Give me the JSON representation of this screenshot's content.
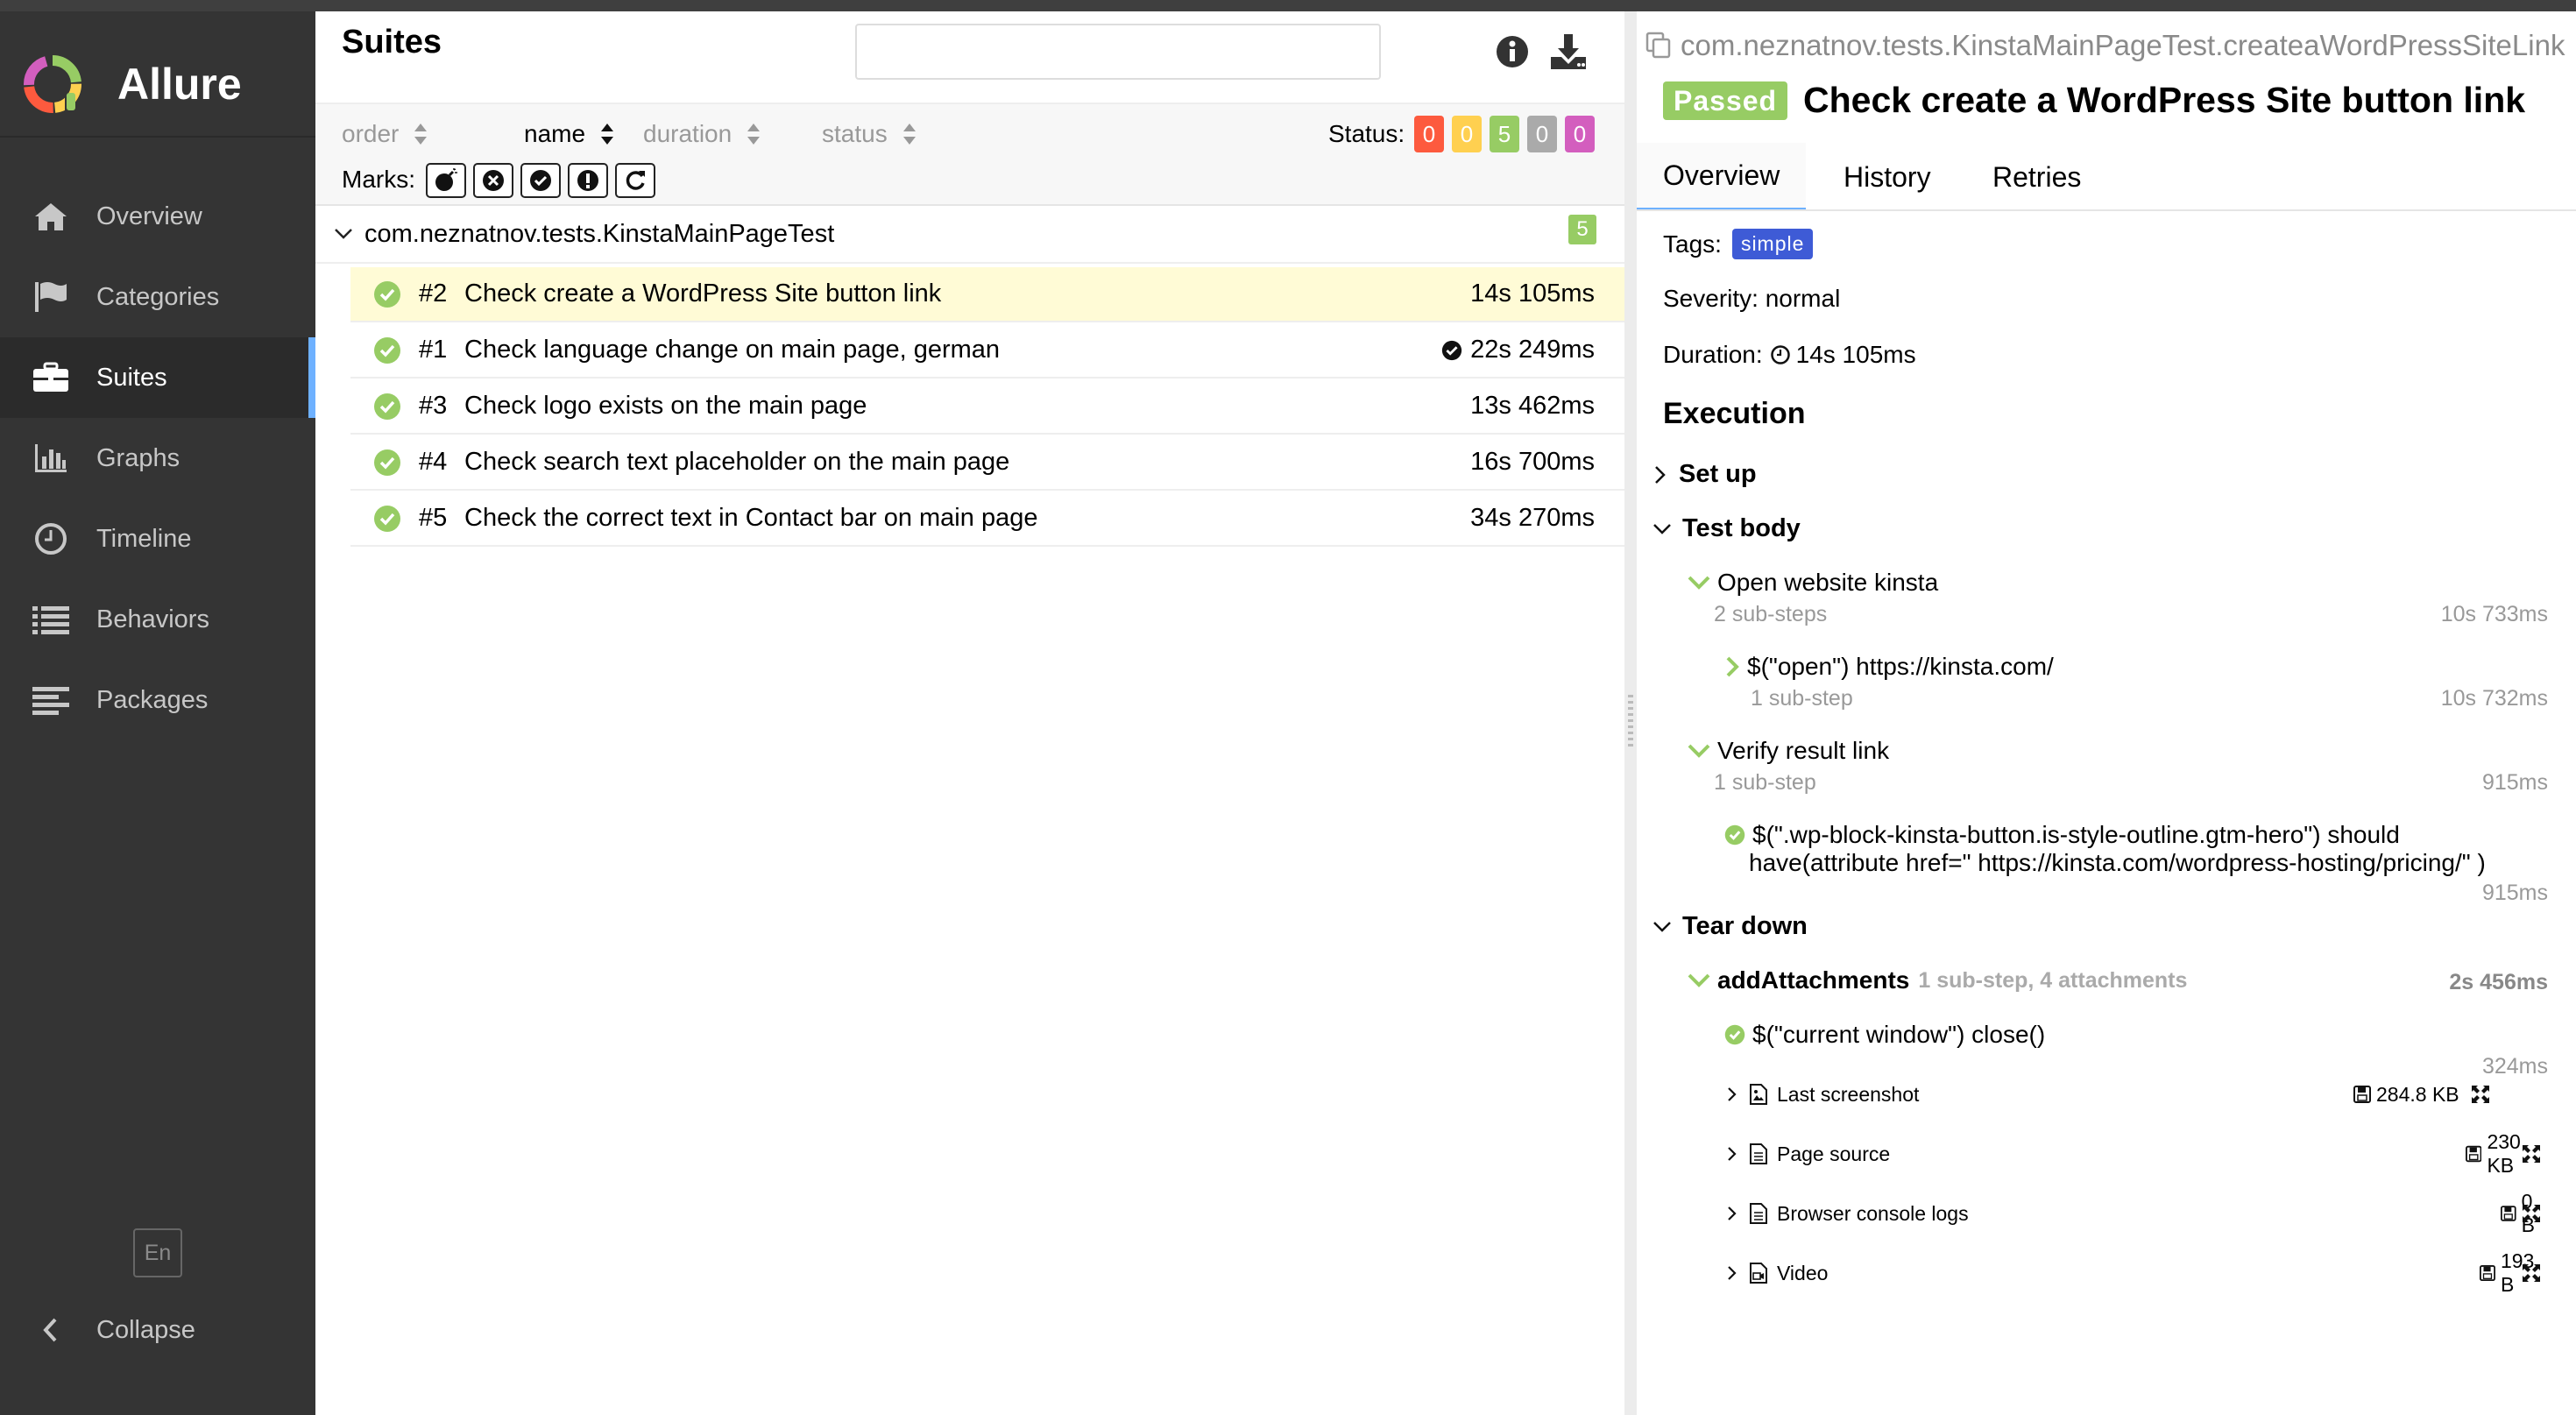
{
  "app": {
    "name": "Allure",
    "accent": "#6eb1ff"
  },
  "nav": [
    {
      "label": "Overview",
      "icon": "home-icon"
    },
    {
      "label": "Categories",
      "icon": "flag-icon"
    },
    {
      "label": "Suites",
      "icon": "briefcase-icon",
      "active": true
    },
    {
      "label": "Graphs",
      "icon": "bar-chart-icon"
    },
    {
      "label": "Timeline",
      "icon": "clock-icon"
    },
    {
      "label": "Behaviors",
      "icon": "list-icon"
    },
    {
      "label": "Packages",
      "icon": "align-left-icon"
    }
  ],
  "language": "En",
  "collapse_label": "Collapse",
  "suites": {
    "title": "Suites",
    "search_value": "",
    "sort": {
      "order": "order",
      "name": "name",
      "duration": "duration",
      "status": "status",
      "active": "name"
    },
    "status_label": "Status:",
    "status_counts": [
      {
        "value": "0",
        "color": "#fd5a3e"
      },
      {
        "value": "0",
        "color": "#ffd050"
      },
      {
        "value": "5",
        "color": "#97cc64"
      },
      {
        "value": "0",
        "color": "#aaaaaa"
      },
      {
        "value": "0",
        "color": "#d35ebe"
      }
    ],
    "marks_label": "Marks:",
    "group": {
      "name": "com.neznatnov.tests.KinstaMainPageTest",
      "count": "5"
    },
    "tests": [
      {
        "num": "#2",
        "name": "Check create a WordPress Site button link",
        "duration": "14s 105ms",
        "selected": true
      },
      {
        "num": "#1",
        "name": "Check language change on main page, german",
        "duration": "22s 249ms",
        "flag": true
      },
      {
        "num": "#3",
        "name": "Check logo exists on the main page",
        "duration": "13s 462ms"
      },
      {
        "num": "#4",
        "name": "Check search text placeholder on the main page",
        "duration": "16s 700ms"
      },
      {
        "num": "#5",
        "name": "Check the correct text in Contact bar on main page",
        "duration": "34s 270ms"
      }
    ]
  },
  "detail": {
    "full_name": "com.neznatnov.tests.KinstaMainPageTest.createaWordPressSiteLink",
    "status": "Passed",
    "title": "Check create a WordPress Site button link",
    "tabs": [
      "Overview",
      "History",
      "Retries"
    ],
    "tags_label": "Tags:",
    "tag": "simple",
    "severity": "Severity: normal",
    "duration_label": "Duration:",
    "duration": "14s 105ms",
    "execution": "Execution",
    "setup": "Set up",
    "test_body": "Test body",
    "steps": {
      "open": {
        "name": "Open website kinsta",
        "sub": "2 sub-steps",
        "time": "10s 733ms"
      },
      "open_url": {
        "name": "$(\"open\") https://kinsta.com/",
        "sub": "1 sub-step",
        "time": "10s 732ms"
      },
      "verify": {
        "name": "Verify result link",
        "sub": "1 sub-step",
        "time": "915ms"
      },
      "verify_should_1": "$(\".wp-block-kinsta-button.is-style-outline.gtm-hero\") should",
      "verify_should_2": "have(attribute href=\" https://kinsta.com/wordpress-hosting/pricing/\" )",
      "verify_should_time": "915ms"
    },
    "teardown": "Tear down",
    "add_attachments": {
      "name": "addAttachments",
      "sub": "1 sub-step, 4 attachments",
      "time": "2s 456ms"
    },
    "close": {
      "name": "$(\"current window\") close()",
      "time": "324ms"
    },
    "attachments": [
      {
        "name": "Last screenshot",
        "size": "284.8 KB",
        "icon": "image-file-icon"
      },
      {
        "name": "Page source",
        "size": "230 KB",
        "icon": "text-file-icon"
      },
      {
        "name": "Browser console logs",
        "size": "0 B",
        "icon": "text-file-icon"
      },
      {
        "name": "Video",
        "size": "193 B",
        "icon": "video-file-icon"
      }
    ]
  }
}
